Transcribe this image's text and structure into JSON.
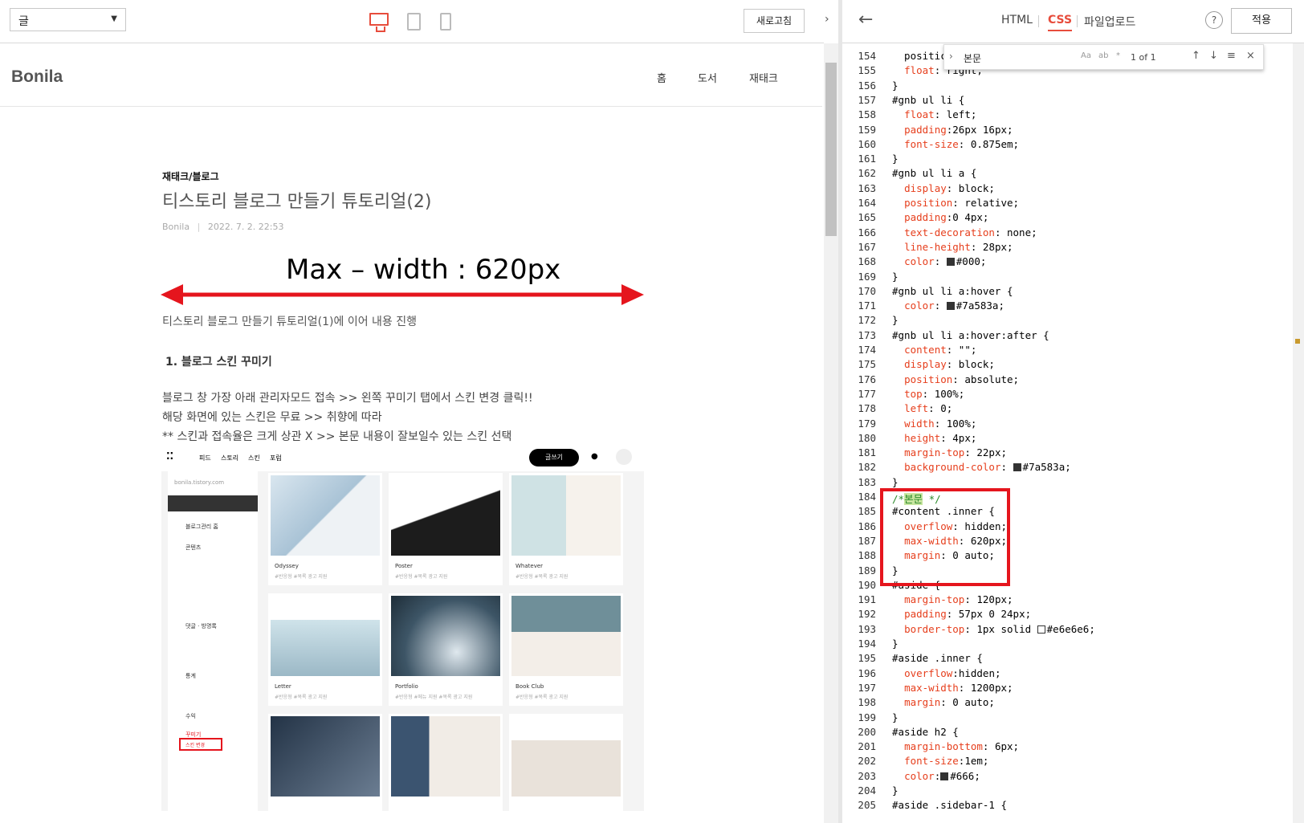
{
  "toolbar": {
    "view_select": "글",
    "refresh_label": "새로고침"
  },
  "blog": {
    "logo": "Bonila",
    "nav": [
      "홈",
      "도서",
      "재태크"
    ]
  },
  "post": {
    "category": "재태크/블로그",
    "title": "티스토리 블로그 만들기 튜토리얼(2)",
    "author": "Bonila",
    "date": "2022. 7. 2. 22:53",
    "annotation": "Max – width : 620px",
    "intro": "티스토리 블로그 만들기 튜토리얼(1)에 이어 내용 진행",
    "section_title": "1. 블로그 스킨 꾸미기",
    "lines": [
      "블로그 창 가장 아래 관리자모드 접속 >> 왼쪽 꾸미기 탭에서 스킨 변경 클릭!!",
      "해당 화면에 있는 스킨은 무료 >> 취향에 따라",
      "** 스킨과 접속율은 크게 상관 X >> 본문 내용이 잘보일수 있는 스킨 선택"
    ]
  },
  "screenshot": {
    "menu": [
      "피드",
      "스토리",
      "스킨",
      "포럼"
    ],
    "write_btn": "글쓰기",
    "url": "bonila.tistory.com",
    "sidebar": [
      "블로그관리 홈",
      "콘텐츠",
      "댓글 · 방명록",
      "통계",
      "수익",
      "꾸미기",
      "스킨 변경"
    ],
    "skins": [
      {
        "name": "Odyssey",
        "tags": "#반응형 #목록 광고 지원"
      },
      {
        "name": "Poster",
        "tags": "#반응형 #목록 광고 지원"
      },
      {
        "name": "Whatever",
        "tags": "#반응형 #목록 광고 지원"
      },
      {
        "name": "Letter",
        "tags": "#반응형 #목록 광고 지원"
      },
      {
        "name": "Portfolio",
        "tags": "#반응형 #메뉴 지원 #목록 광고 지원"
      },
      {
        "name": "Book Club",
        "tags": "#반응형 #목록 광고 지원"
      }
    ]
  },
  "editor": {
    "tabs": [
      "HTML",
      "CSS",
      "파일업로드"
    ],
    "active_tab": "CSS",
    "help": "?",
    "apply_label": "적용",
    "find": {
      "query": "본문",
      "count": "1 of 1",
      "opts": [
        "Aa",
        "ab",
        "*"
      ]
    },
    "lines": [
      {
        "n": "154",
        "t": "  positic"
      },
      {
        "n": "155",
        "t": "  float: right;"
      },
      {
        "n": "156",
        "t": "}"
      },
      {
        "n": "157",
        "t": "#gnb ul li {"
      },
      {
        "n": "158",
        "t": "  float: left;"
      },
      {
        "n": "159",
        "t": "  padding:26px 16px;"
      },
      {
        "n": "160",
        "t": "  font-size: 0.875em;"
      },
      {
        "n": "161",
        "t": "}"
      },
      {
        "n": "162",
        "t": "#gnb ul li a {"
      },
      {
        "n": "163",
        "t": "  display: block;"
      },
      {
        "n": "164",
        "t": "  position: relative;"
      },
      {
        "n": "165",
        "t": "  padding:0 4px;"
      },
      {
        "n": "166",
        "t": "  text-decoration: none;"
      },
      {
        "n": "167",
        "t": "  line-height: 28px;"
      },
      {
        "n": "168",
        "t": "  color: ■#000;"
      },
      {
        "n": "169",
        "t": "}"
      },
      {
        "n": "170",
        "t": "#gnb ul li a:hover {"
      },
      {
        "n": "171",
        "t": "  color: ■#7a583a;"
      },
      {
        "n": "172",
        "t": "}"
      },
      {
        "n": "173",
        "t": "#gnb ul li a:hover:after {"
      },
      {
        "n": "174",
        "t": "  content: \"\";"
      },
      {
        "n": "175",
        "t": "  display: block;"
      },
      {
        "n": "176",
        "t": "  position: absolute;"
      },
      {
        "n": "177",
        "t": "  top: 100%;"
      },
      {
        "n": "178",
        "t": "  left: 0;"
      },
      {
        "n": "179",
        "t": "  width: 100%;"
      },
      {
        "n": "180",
        "t": "  height: 4px;"
      },
      {
        "n": "181",
        "t": "  margin-top: 22px;"
      },
      {
        "n": "182",
        "t": "  background-color: ■#7a583a;"
      },
      {
        "n": "183",
        "t": "}"
      },
      {
        "n": "184",
        "t": "/*본문 */"
      },
      {
        "n": "185",
        "t": "#content .inner {"
      },
      {
        "n": "186",
        "t": "  overflow: hidden;"
      },
      {
        "n": "187",
        "t": "  max-width: 620px;"
      },
      {
        "n": "188",
        "t": "  margin: 0 auto;"
      },
      {
        "n": "189",
        "t": "}"
      },
      {
        "n": "190",
        "t": "#aside {"
      },
      {
        "n": "191",
        "t": "  margin-top: 120px;"
      },
      {
        "n": "192",
        "t": "  padding: 57px 0 24px;"
      },
      {
        "n": "193",
        "t": "  border-top: 1px solid □#e6e6e6;"
      },
      {
        "n": "194",
        "t": "}"
      },
      {
        "n": "195",
        "t": "#aside .inner {"
      },
      {
        "n": "196",
        "t": "  overflow:hidden;"
      },
      {
        "n": "197",
        "t": "  max-width: 1200px;"
      },
      {
        "n": "198",
        "t": "  margin: 0 auto;"
      },
      {
        "n": "199",
        "t": "}"
      },
      {
        "n": "200",
        "t": "#aside h2 {"
      },
      {
        "n": "201",
        "t": "  margin-bottom: 6px;"
      },
      {
        "n": "202",
        "t": "  font-size:1em;"
      },
      {
        "n": "203",
        "t": "  color:■#666;"
      },
      {
        "n": "204",
        "t": "}"
      },
      {
        "n": "205",
        "t": "#aside .sidebar-1 {"
      }
    ]
  },
  "colors": {
    "accent": "#e74c3c",
    "annotation_red": "#e5151d",
    "swatch_brown": "#7a583a"
  }
}
